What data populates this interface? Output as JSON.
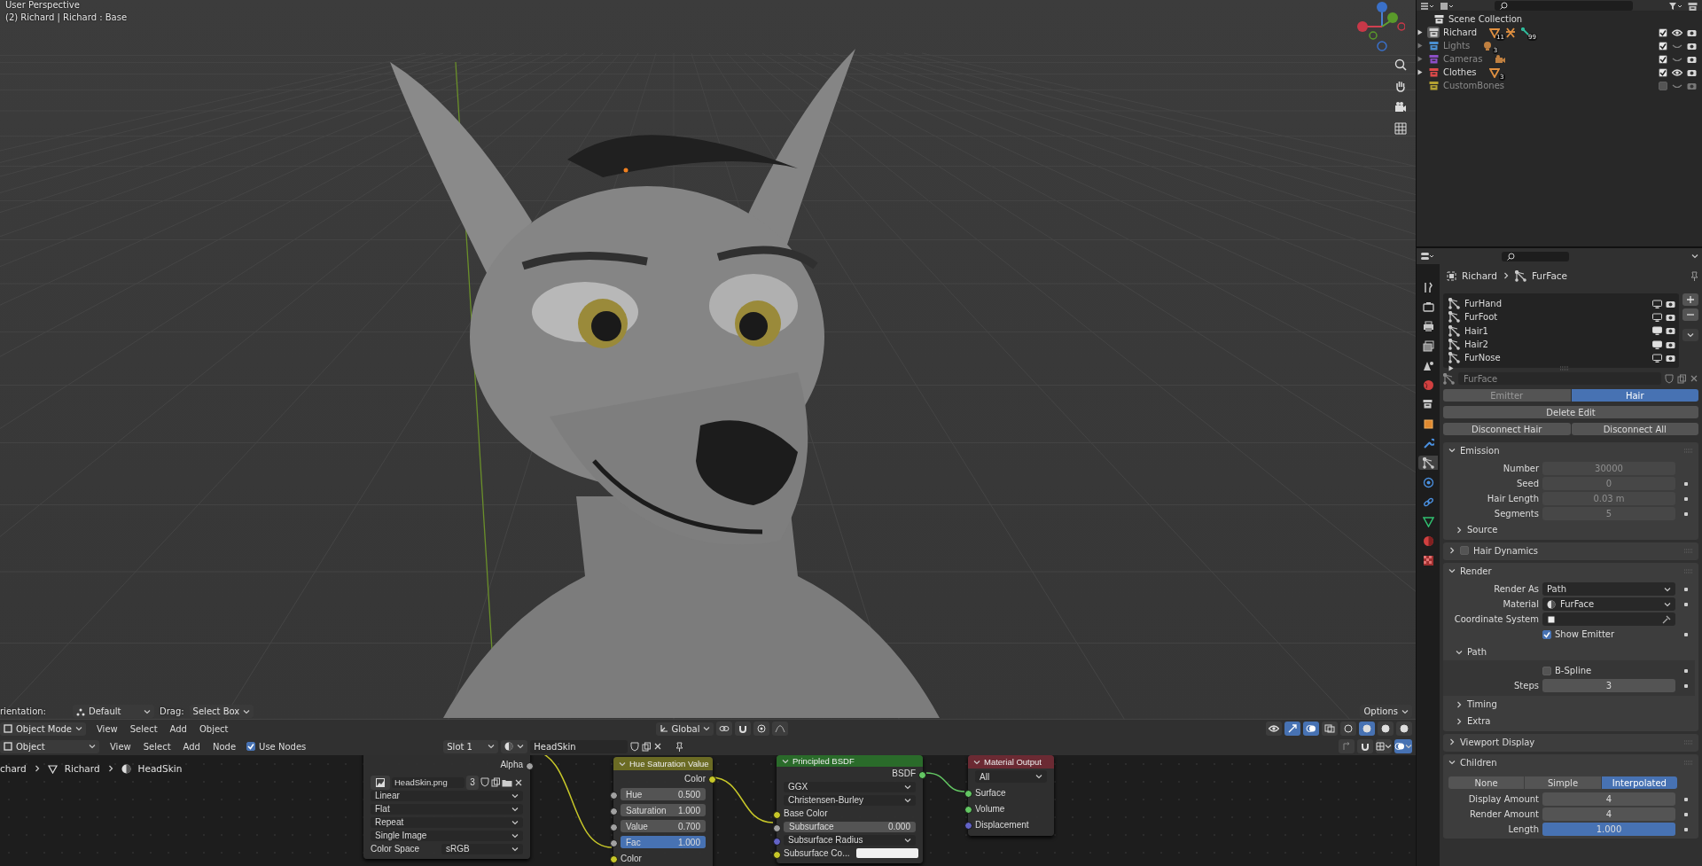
{
  "viewport": {
    "view_name": "User Perspective",
    "object_info": "(2) Richard | Richard : Base",
    "tool_settings": {
      "orientation_label": "rientation:",
      "orientation": "Default",
      "drag_label": "Drag:",
      "drag": "Select Box",
      "options": "Options"
    },
    "header": {
      "mode": "Object Mode",
      "menus": [
        "View",
        "Select",
        "Add",
        "Object"
      ],
      "orientation": "Global"
    }
  },
  "node_editor": {
    "header": {
      "type": "Object",
      "menus": [
        "View",
        "Select",
        "Add",
        "Node"
      ],
      "use_nodes": {
        "label": "Use Nodes",
        "checked": true
      },
      "slot": "Slot 1",
      "material": "HeadSkin"
    },
    "breadcrumb": [
      "chard",
      "Richard",
      "HeadSkin"
    ],
    "nodes": [
      {
        "kind": "image_texture",
        "rows": [
          {
            "kind": "output",
            "label": "Alpha",
            "color": "#a1a1a1"
          },
          {
            "kind": "image",
            "value": "HeadSkin.png",
            "users": "3"
          },
          {
            "kind": "dropdown",
            "value": "Linear"
          },
          {
            "kind": "dropdown",
            "value": "Flat"
          },
          {
            "kind": "dropdown",
            "value": "Repeat"
          },
          {
            "kind": "dropdown",
            "value": "Single Image"
          },
          {
            "kind": "labeled_dropdown",
            "label": "Color Space",
            "value": "sRGB"
          }
        ]
      },
      {
        "kind": "hsv",
        "title": "Hue Saturation Value",
        "color": "#6b6b24",
        "rows": [
          {
            "kind": "output",
            "label": "Color",
            "color": "#c7c729"
          },
          {
            "kind": "number",
            "label": "Hue",
            "value": "0.500",
            "color": "#a1a1a1"
          },
          {
            "kind": "number",
            "label": "Saturation",
            "value": "1.000",
            "color": "#a1a1a1"
          },
          {
            "kind": "number",
            "label": "Value",
            "value": "0.700",
            "color": "#a1a1a1"
          },
          {
            "kind": "slider",
            "label": "Fac",
            "value": "1.000",
            "level": 1,
            "color": "#a1a1a1"
          },
          {
            "kind": "input",
            "label": "Color",
            "color": "#c7c729"
          }
        ]
      },
      {
        "kind": "bsdf",
        "title": "Principled BSDF",
        "color": "#2a6b2a",
        "rows": [
          {
            "kind": "output",
            "label": "BSDF",
            "color": "#63c763"
          },
          {
            "kind": "dropdown",
            "value": "GGX"
          },
          {
            "kind": "dropdown",
            "value": "Christensen-Burley"
          },
          {
            "kind": "input",
            "label": "Base Color",
            "color": "#c7c729"
          },
          {
            "kind": "slider",
            "label": "Subsurface",
            "value": "0.000",
            "level": 0,
            "color": "#a1a1a1"
          },
          {
            "kind": "dropdown",
            "value": "Subsurface Radius",
            "color": "#6363c7"
          },
          {
            "kind": "color_input",
            "label": "Subsurface Co...",
            "color": "#c7c729"
          }
        ]
      },
      {
        "kind": "output",
        "title": "Material Output",
        "color": "#6b2a33",
        "rows": [
          {
            "kind": "dropdown",
            "value": "All"
          },
          {
            "kind": "input",
            "label": "Surface",
            "color": "#63c763"
          },
          {
            "kind": "input",
            "label": "Volume",
            "color": "#63c763"
          },
          {
            "kind": "input",
            "label": "Displacement",
            "color": "#6363c7"
          }
        ]
      }
    ]
  },
  "outliner": {
    "rows": [
      {
        "name": "Scene Collection",
        "children": [
          {
            "name": "Richard",
            "color": "#d0d0d0",
            "active": true,
            "hidden": false,
            "checked": true,
            "badges": [
              {
                "kind": "mesh",
                "count": "11"
              },
              {
                "kind": "armature"
              },
              {
                "kind": "bone",
                "count": "99"
              }
            ]
          },
          {
            "name": "Lights",
            "color": "#4a8fd1",
            "active": false,
            "hidden": true,
            "checked": true,
            "badges": [
              {
                "kind": "light",
                "count": "3"
              }
            ]
          },
          {
            "name": "Cameras",
            "color": "#8c4fc7",
            "active": false,
            "hidden": true,
            "checked": true,
            "badges": [
              {
                "kind": "camera"
              }
            ]
          },
          {
            "name": "Clothes",
            "color": "#e04a4a",
            "active": false,
            "hidden": false,
            "checked": true,
            "badges": [
              {
                "kind": "mesh",
                "count": "3"
              }
            ]
          },
          {
            "name": "CustomBones",
            "color": "#b3a032",
            "active": false,
            "hidden": true,
            "checked": false
          }
        ]
      }
    ]
  },
  "properties": {
    "tabs": [
      {
        "kind": "tool",
        "selected": false
      },
      {
        "kind": "render",
        "selected": false
      },
      {
        "kind": "output",
        "selected": false
      },
      {
        "kind": "view_layer",
        "selected": false
      },
      {
        "kind": "scene",
        "selected": false
      },
      {
        "kind": "world",
        "selected": false
      },
      {
        "kind": "collection",
        "selected": false
      },
      {
        "kind": "object",
        "selected": false
      },
      {
        "kind": "modifier",
        "selected": false
      },
      {
        "kind": "particles",
        "selected": true
      },
      {
        "kind": "physics",
        "selected": false
      },
      {
        "kind": "constraint",
        "selected": false
      },
      {
        "kind": "data",
        "selected": false
      },
      {
        "kind": "material",
        "selected": false
      },
      {
        "kind": "texture",
        "selected": false
      }
    ],
    "breadcrumb": [
      "Richard",
      "FurFace"
    ],
    "systems": [
      {
        "name": "FurHand",
        "viewport": false
      },
      {
        "name": "FurFoot",
        "viewport": false
      },
      {
        "name": "Hair1",
        "viewport": true
      },
      {
        "name": "Hair2",
        "viewport": true
      },
      {
        "name": "FurNose",
        "viewport": false
      }
    ],
    "settings": "FurFace",
    "types": [
      {
        "label": "Emitter",
        "selected": false
      },
      {
        "label": "Hair",
        "selected": true
      }
    ],
    "actions": [
      [
        "Delete Edit"
      ],
      [
        "Disconnect Hair",
        "Disconnect All"
      ]
    ],
    "panels": [
      {
        "title": "Emission",
        "expanded": true,
        "rows": [
          {
            "kind": "number",
            "label": "Number",
            "value": "30000",
            "disabled": true,
            "decorator": false
          },
          {
            "kind": "number",
            "label": "Seed",
            "value": "0",
            "disabled": true,
            "decorator": true
          },
          {
            "kind": "number",
            "label": "Hair Length",
            "value": "0.03 m",
            "disabled": true,
            "decorator": true
          },
          {
            "kind": "number",
            "label": "Segments",
            "value": "5",
            "disabled": true,
            "decorator": true
          },
          {
            "kind": "subpanel",
            "title": "Source",
            "expanded": false,
            "rows": []
          }
        ]
      },
      {
        "title": "Hair Dynamics",
        "expanded": false,
        "checkbox": false
      },
      {
        "title": "Render",
        "expanded": true,
        "rows": [
          {
            "kind": "dropdown",
            "label": "Render As",
            "value": "Path",
            "decorator": true
          },
          {
            "kind": "material_dropdown",
            "label": "Material",
            "value": "FurFace",
            "decorator": true
          },
          {
            "kind": "object_field",
            "label": "Coordinate System"
          },
          {
            "kind": "checkbox",
            "label": "Show Emitter",
            "checked": true,
            "decorator": true
          },
          {
            "kind": "subpanel",
            "title": "Path",
            "expanded": true,
            "rows": [
              {
                "kind": "checkbox",
                "label": "B-Spline",
                "checked": false,
                "decorator": true
              },
              {
                "kind": "number",
                "label": "Steps",
                "value": "3",
                "disabled": false,
                "decorator": true
              }
            ]
          },
          {
            "kind": "subpanel",
            "title": "Timing",
            "expanded": false,
            "rows": []
          },
          {
            "kind": "subpanel",
            "title": "Extra",
            "expanded": false,
            "rows": []
          }
        ]
      },
      {
        "title": "Viewport Display",
        "expanded": false
      },
      {
        "title": "Children",
        "expanded": true,
        "rows": [
          {
            "kind": "segmented",
            "options": [
              {
                "label": "None",
                "selected": false
              },
              {
                "label": "Simple",
                "selected": false
              },
              {
                "label": "Interpolated",
                "selected": true
              }
            ]
          },
          {
            "kind": "number",
            "label": "Display Amount",
            "value": "4",
            "disabled": false,
            "decorator": true
          },
          {
            "kind": "number",
            "label": "Render Amount",
            "value": "4",
            "disabled": false,
            "decorator": true
          },
          {
            "kind": "slider",
            "label": "Length",
            "value": "1.000",
            "level": 1,
            "decorator": true
          }
        ]
      }
    ]
  }
}
